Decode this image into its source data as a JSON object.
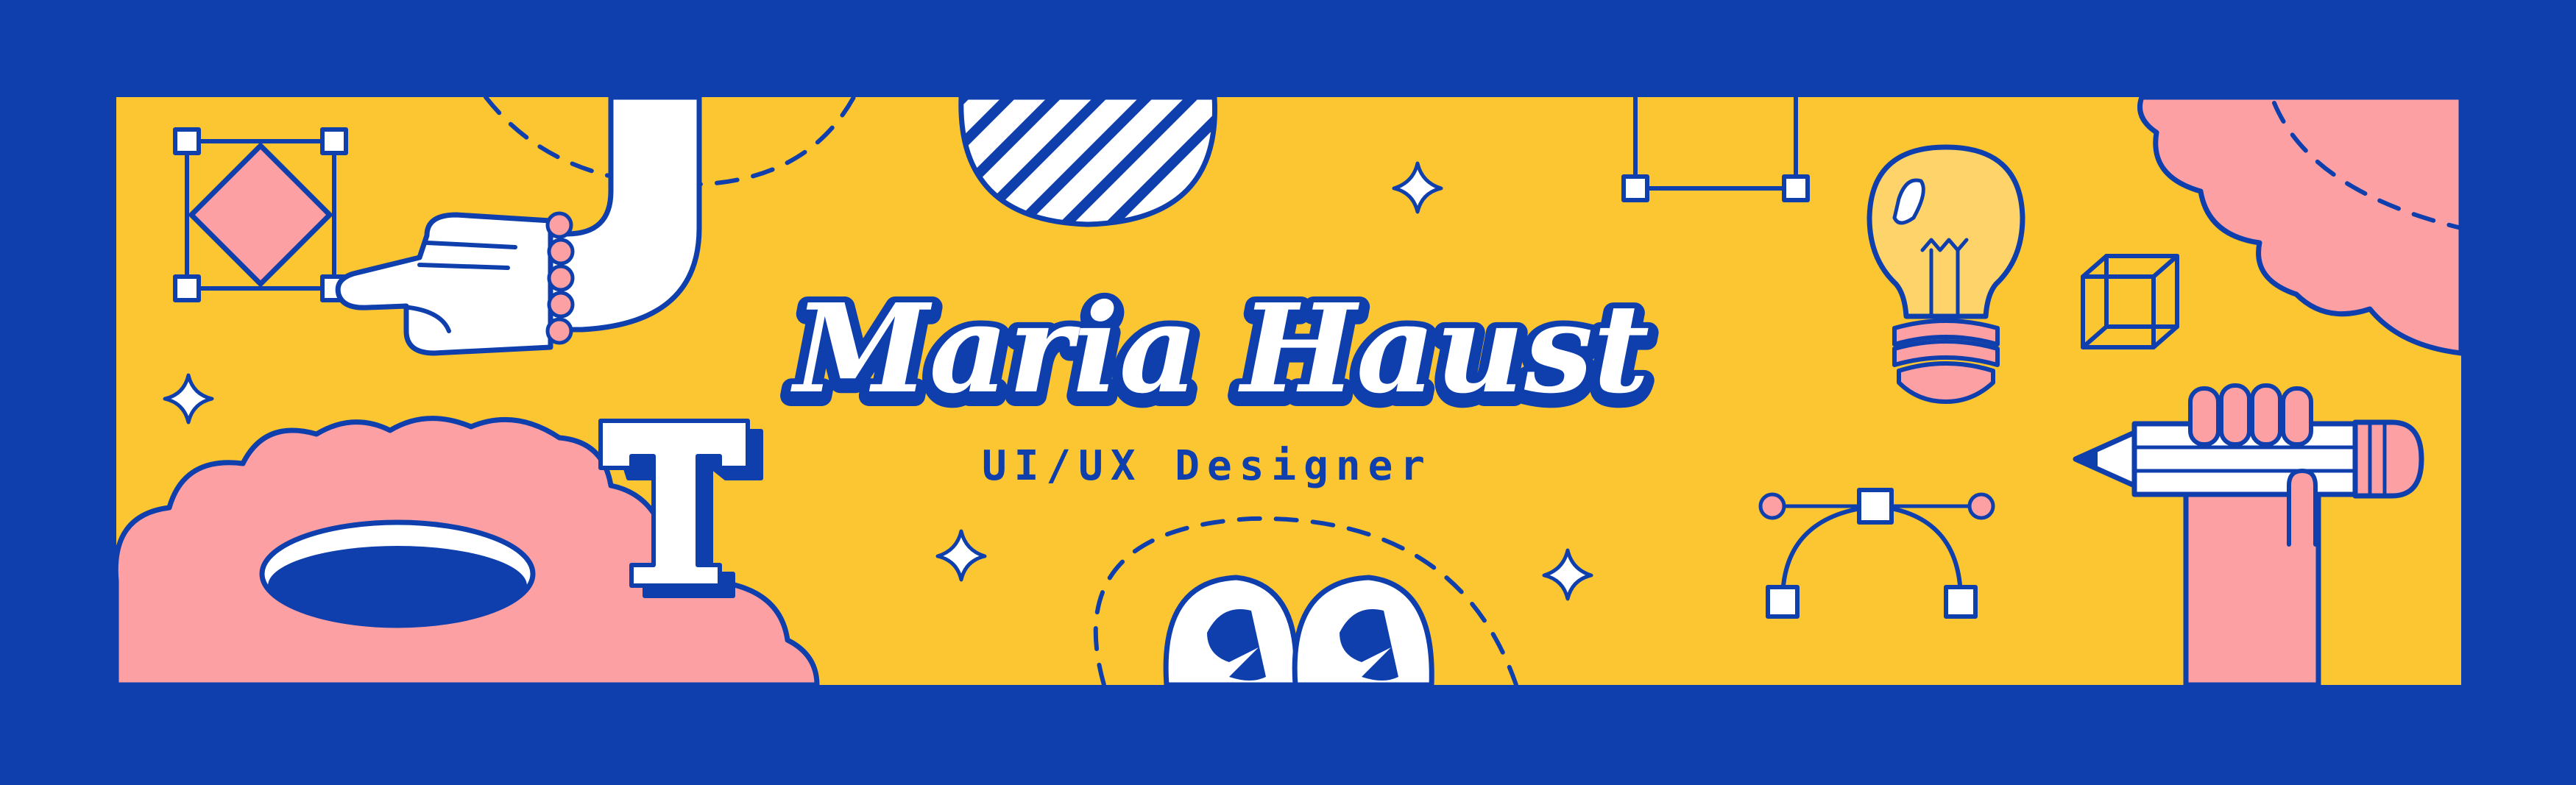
{
  "banner": {
    "name": "Maria Haust",
    "role": "UI/UX Designer"
  },
  "colors": {
    "frame": "#0f3fad",
    "background": "#fcc532",
    "pink": "#fca0a4",
    "outline": "#0f3fad",
    "white": "#ffffff",
    "bulb": "#fdd36a"
  },
  "icons": [
    "transform-frame-icon",
    "pointing-hand-icon",
    "sparkle-icon",
    "pink-cloud-icon",
    "hole-icon",
    "letter-t-icon",
    "striped-circle-icon",
    "selection-frame-icon",
    "lightbulb-icon",
    "cube-icon",
    "bezier-curve-icon",
    "googly-eyes-icon",
    "pencil-hand-icon"
  ],
  "letter_icon_glyph": "T"
}
